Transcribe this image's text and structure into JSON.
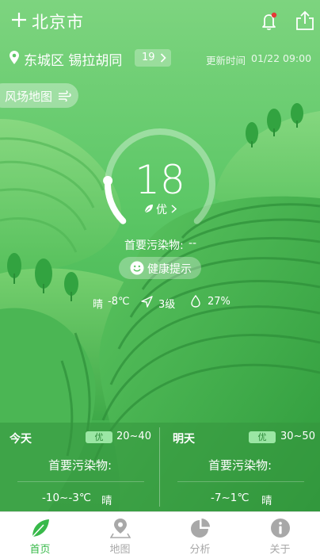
{
  "header": {
    "city": "北京市"
  },
  "location": {
    "district": "东城区 锡拉胡同",
    "station_count": "19",
    "update_label": "更新时间",
    "update_time": "01/22 09:00"
  },
  "wind_map": {
    "label": "风场地图"
  },
  "aqi": {
    "value": "18",
    "level": "优",
    "progress": 0.18,
    "primary_pollutant_label": "首要污染物:",
    "primary_pollutant_value": "--"
  },
  "health": {
    "label": "健康提示"
  },
  "weather": {
    "condition": "晴",
    "temperature": "-8℃",
    "wind_level": "3级",
    "humidity": "27%"
  },
  "forecast": {
    "today": {
      "day": "今天",
      "level": "优",
      "range": "20~40",
      "pollutant_label": "首要污染物:",
      "temp_range": "-10~-3℃",
      "condition": "晴"
    },
    "tomorrow": {
      "day": "明天",
      "level": "优",
      "range": "30~50",
      "pollutant_label": "首要污染物:",
      "temp_range": "-7~1℃",
      "condition": "晴"
    }
  },
  "tabs": [
    {
      "label": "首页",
      "icon": "leaf-icon",
      "active": true
    },
    {
      "label": "地图",
      "icon": "map-pin-icon",
      "active": false
    },
    {
      "label": "分析",
      "icon": "pie-chart-icon",
      "active": false
    },
    {
      "label": "关于",
      "icon": "info-icon",
      "active": false
    }
  ],
  "colors": {
    "accent": "#38b94a",
    "background": "#5cc766",
    "notification_dot": "#e53935",
    "tab_inactive": "#a8a8a8"
  }
}
